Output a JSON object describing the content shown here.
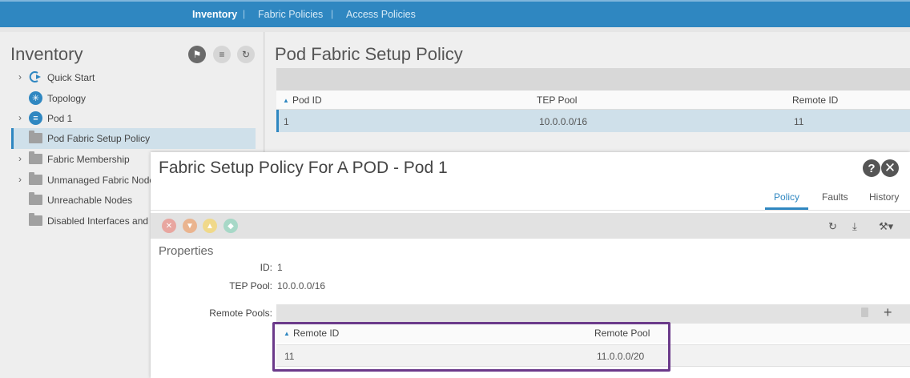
{
  "topnav": {
    "tabs": [
      {
        "label": "Inventory",
        "active": true
      },
      {
        "label": "Fabric Policies",
        "active": false
      },
      {
        "label": "Access Policies",
        "active": false
      }
    ],
    "separator": "|"
  },
  "left": {
    "title": "Inventory",
    "buttons": [
      "tag-icon",
      "filter-list-icon",
      "refresh-icon"
    ],
    "tree": [
      {
        "label": "Quick Start",
        "icon": "quick-start-icon",
        "expandable": true
      },
      {
        "label": "Topology",
        "icon": "topology-icon",
        "expandable": false
      },
      {
        "label": "Pod 1",
        "icon": "pod-icon",
        "expandable": true
      },
      {
        "label": "Pod Fabric Setup Policy",
        "icon": "folder-icon",
        "expandable": false,
        "selected": true
      },
      {
        "label": "Fabric Membership",
        "icon": "folder-icon",
        "expandable": true
      },
      {
        "label": "Unmanaged Fabric Node",
        "icon": "folder-icon",
        "expandable": true
      },
      {
        "label": "Unreachable Nodes",
        "icon": "folder-icon",
        "expandable": false
      },
      {
        "label": "Disabled Interfaces and D",
        "icon": "folder-icon",
        "expandable": false
      }
    ]
  },
  "main": {
    "title": "Pod Fabric Setup Policy",
    "table": {
      "columns": [
        "Pod ID",
        "TEP Pool",
        "Remote ID"
      ],
      "rows": [
        [
          "1",
          "10.0.0.0/16",
          "11"
        ]
      ]
    }
  },
  "dialog": {
    "title": "Fabric Setup Policy For A POD - Pod 1",
    "tabs": [
      "Policy",
      "Faults",
      "History"
    ],
    "active_tab": "Policy",
    "fault_colors": [
      "#e8a6a0",
      "#eab48f",
      "#f0d98a",
      "#a7d8c7"
    ],
    "properties_title": "Properties",
    "properties": [
      {
        "label": "ID:",
        "value": "1"
      },
      {
        "label": "TEP Pool:",
        "value": "10.0.0.0/16"
      }
    ],
    "remote_pools": {
      "label": "Remote Pools:",
      "columns": [
        "Remote ID",
        "Remote Pool"
      ],
      "rows": [
        [
          "11",
          "11.0.0.0/20"
        ]
      ]
    },
    "highlight_color": "#6b3a8a"
  },
  "colors": {
    "accent": "#2f87c1",
    "selected_row": "#cfe0ea"
  }
}
